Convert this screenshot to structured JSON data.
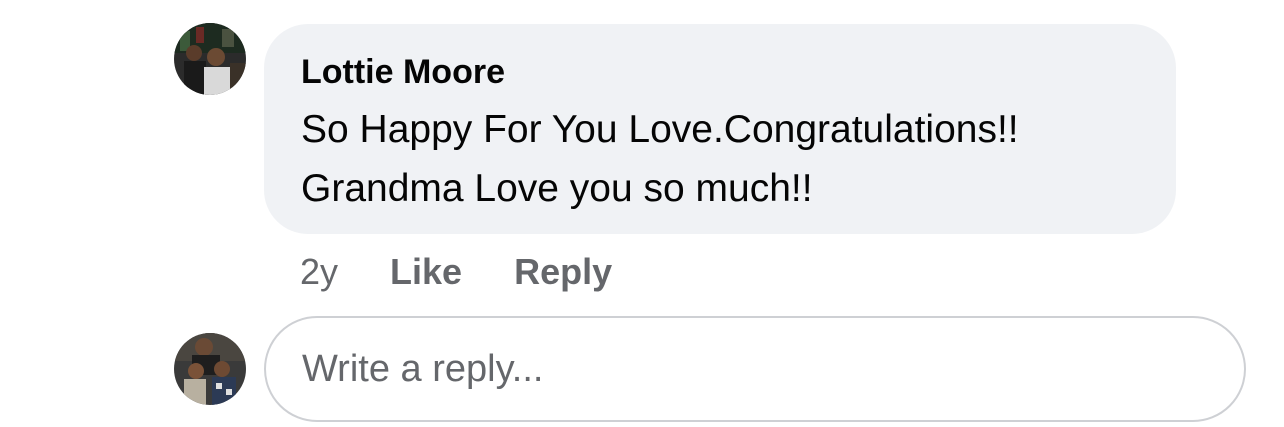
{
  "comment": {
    "author": "Lottie Moore",
    "text_lines": [
      "So Happy For You Love.Congratulations!!",
      "Grandma Love you so much!!"
    ],
    "time": "2y",
    "like_label": "Like",
    "reply_label": "Reply"
  },
  "reply_box": {
    "placeholder": "Write a reply..."
  },
  "colors": {
    "bubble_bg": "#f0f2f5",
    "secondary_text": "#65676b",
    "primary_text": "#050505",
    "input_border": "#ced0d4"
  }
}
